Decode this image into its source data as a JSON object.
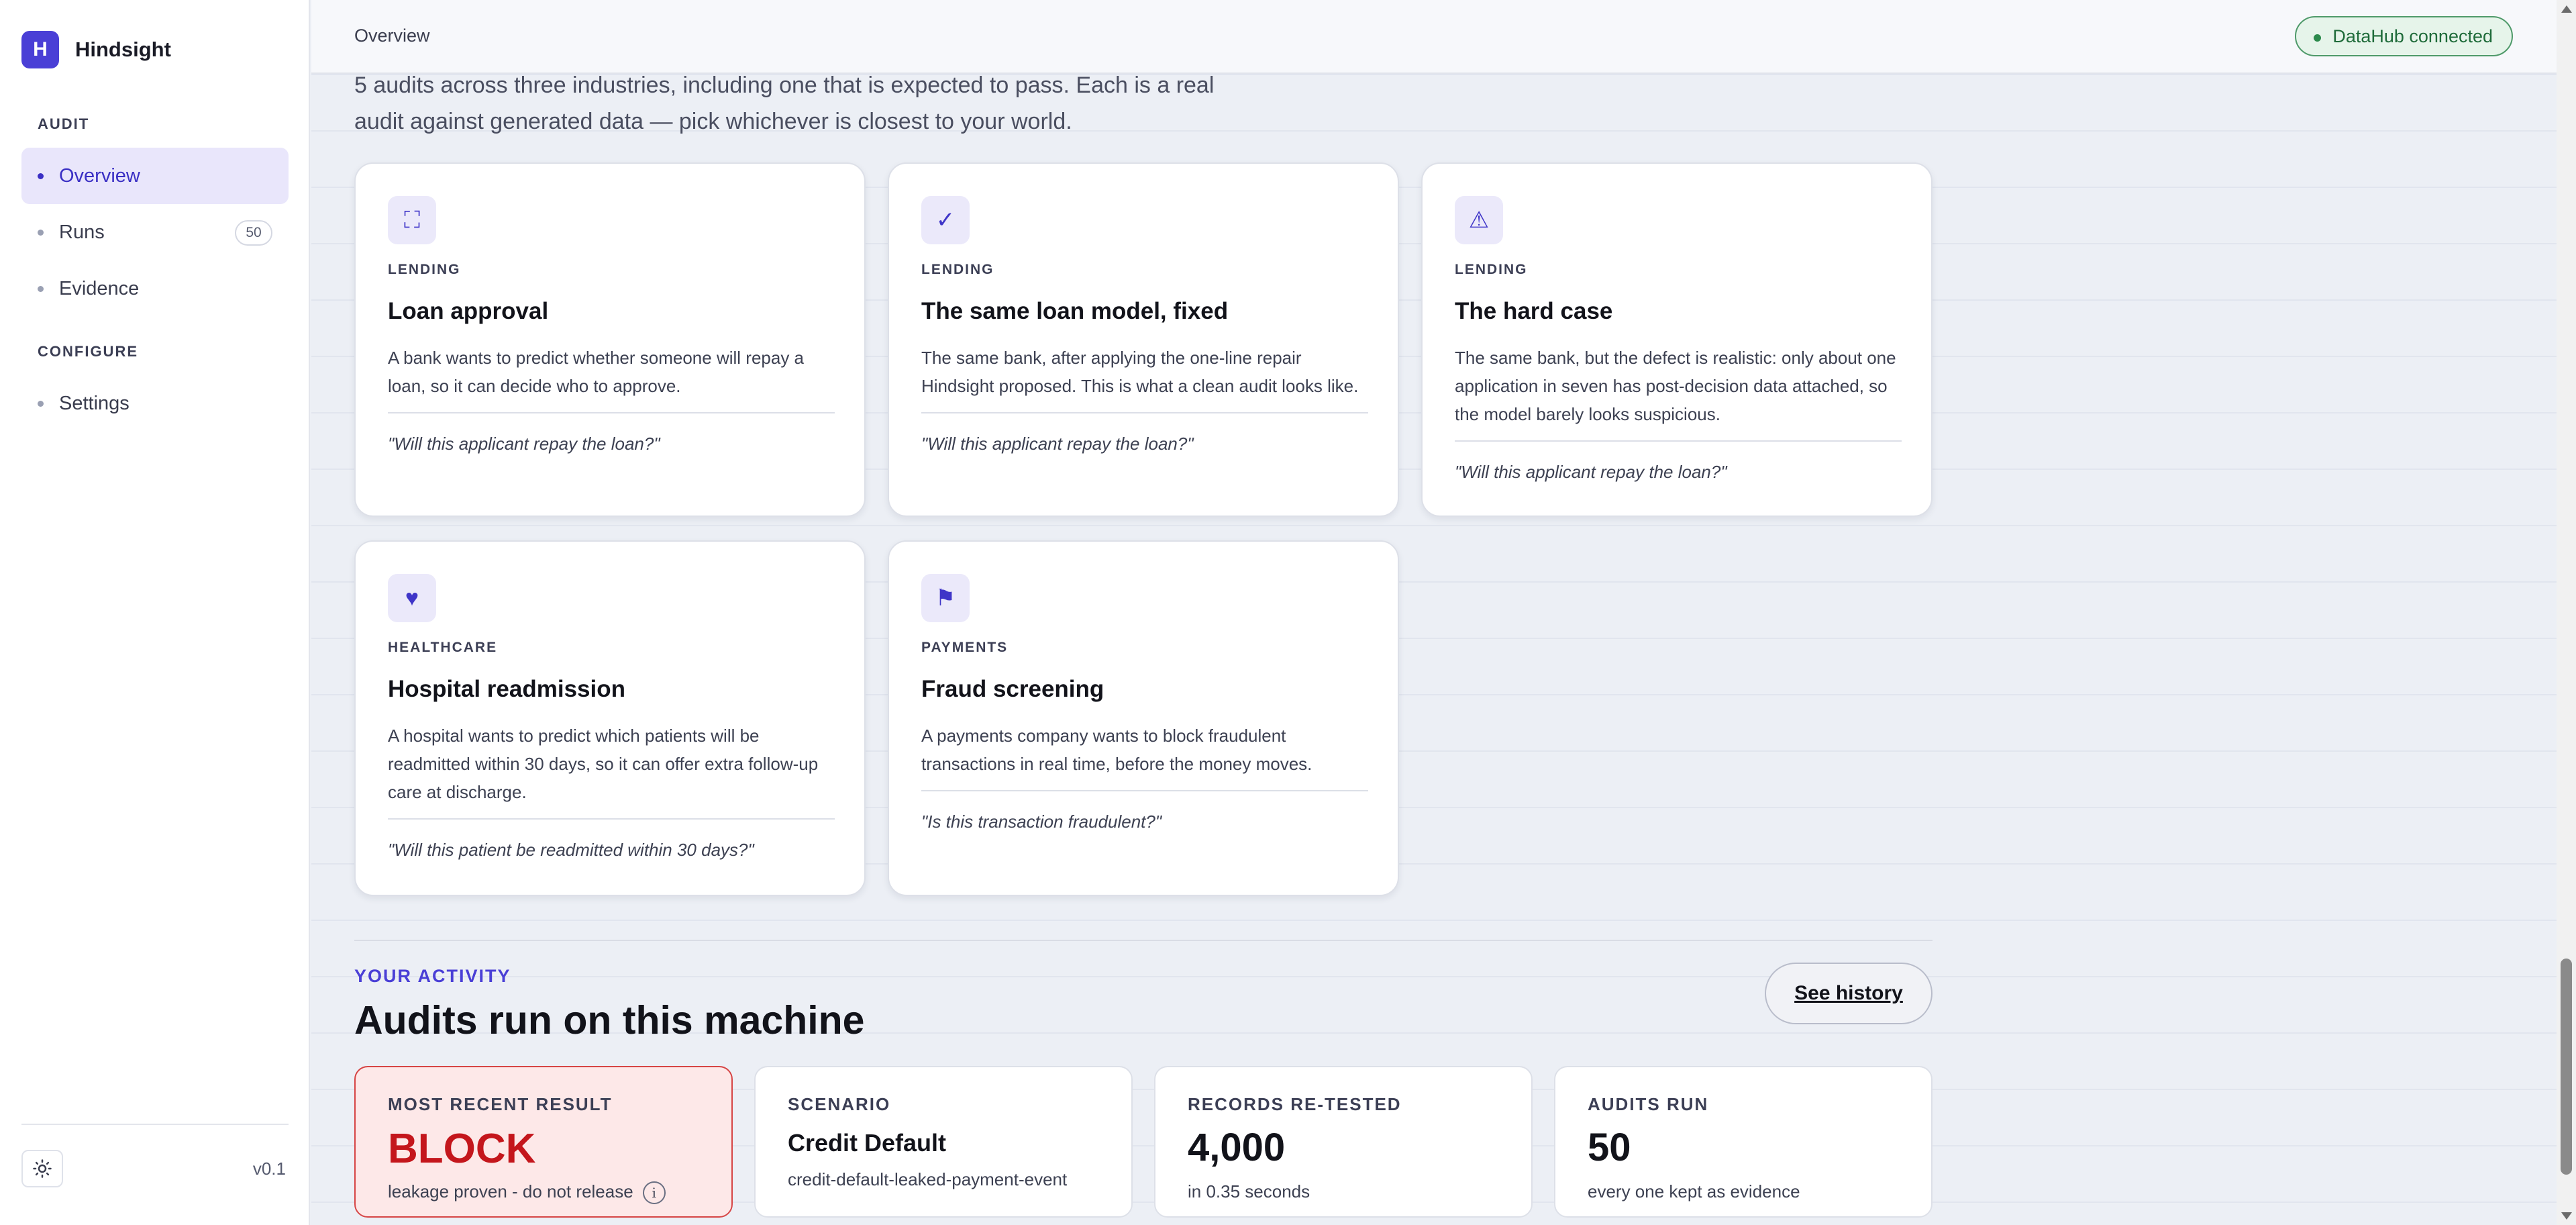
{
  "app": {
    "logo_letter": "H",
    "name": "Hindsight",
    "version": "v0.1"
  },
  "sidebar": {
    "sections": [
      {
        "label": "AUDIT"
      },
      {
        "label": "CONFIGURE"
      }
    ],
    "items": [
      {
        "label": "Overview",
        "active": true
      },
      {
        "label": "Runs",
        "badge": "50"
      },
      {
        "label": "Evidence"
      },
      {
        "label": "Settings"
      }
    ],
    "theme_icon": "sun-icon"
  },
  "topbar": {
    "title": "Overview",
    "status": "DataHub connected"
  },
  "intro": "5 audits across three industries, including one that is expected to pass. Each is a real audit against generated data — pick whichever is closest to your world.",
  "cards": [
    {
      "icon": "expand-icon",
      "glyph": "⛶",
      "tag": "LENDING",
      "title": "Loan approval",
      "desc": "A bank wants to predict whether someone will repay a loan, so it can decide who to approve.",
      "question": "\"Will this applicant repay the loan?\""
    },
    {
      "icon": "check-icon",
      "glyph": "✓",
      "tag": "LENDING",
      "title": "The same loan model, fixed",
      "desc": "The same bank, after applying the one-line repair Hindsight proposed. This is what a clean audit looks like.",
      "question": "\"Will this applicant repay the loan?\""
    },
    {
      "icon": "warning-icon",
      "glyph": "⚠",
      "tag": "LENDING",
      "title": "The hard case",
      "desc": "The same bank, but the defect is realistic: only about one application in seven has post-decision data attached, so the model barely looks suspicious.",
      "question": "\"Will this applicant repay the loan?\""
    },
    {
      "icon": "heart-icon",
      "glyph": "♥",
      "tag": "HEALTHCARE",
      "title": "Hospital readmission",
      "desc": "A hospital wants to predict which patients will be readmitted within 30 days, so it can offer extra follow-up care at discharge.",
      "question": "\"Will this patient be readmitted within 30 days?\""
    },
    {
      "icon": "flag-icon",
      "glyph": "⚑",
      "tag": "PAYMENTS",
      "title": "Fraud screening",
      "desc": "A payments company wants to block fraudulent transactions in real time, before the money moves.",
      "question": "\"Is this transaction fraudulent?\""
    }
  ],
  "activity": {
    "kicker": "YOUR ACTIVITY",
    "title": "Audits run on this machine",
    "history_button": "See history",
    "stats": [
      {
        "label": "MOST RECENT RESULT",
        "value": "BLOCK",
        "sub": "leakage proven - do not release"
      },
      {
        "label": "SCENARIO",
        "value": "Credit Default",
        "sub": "credit-default-leaked-payment-event"
      },
      {
        "label": "RECORDS RE-TESTED",
        "value": "4,000",
        "sub": "in 0.35 seconds"
      },
      {
        "label": "AUDITS RUN",
        "value": "50",
        "sub": "every one kept as evidence"
      }
    ]
  },
  "colors": {
    "accent": "#4a3fd6",
    "block": "#c4161c",
    "status_green": "#2c8a4c"
  }
}
